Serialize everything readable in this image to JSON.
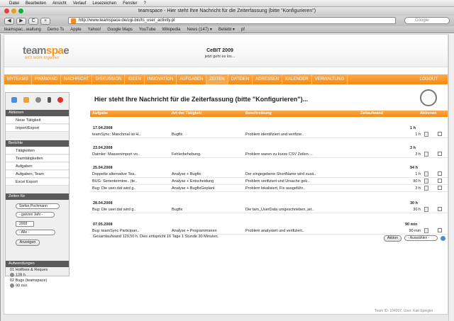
{
  "menubar": {
    "items": [
      "Datei",
      "Bearbeiten",
      "Ansicht",
      "Verlauf",
      "Lesezeichen",
      "Fenster",
      "?"
    ]
  },
  "window": {
    "title": "teamspace - Hier steht Ihre Nachricht für die Zeiterfassung (bitte \"Konfigurieren\")"
  },
  "toolbar": {
    "back": "◀",
    "forward": "▶",
    "reload": "C",
    "add": "+",
    "url": "http://www.teamspace.de/cgi-bin/ts_user_activity.pl",
    "search_placeholder": "Google"
  },
  "bookmarks": [
    "teamspac...waltung",
    "Demo Ts",
    "Apple",
    "Yahoo!",
    "Google Maps",
    "YouTube",
    "Wikipedia",
    "News (147) ▾",
    "Beliebt ▾",
    "pf"
  ],
  "header": {
    "logo_a": "team",
    "logo_b": "spa",
    "logo_c": "e",
    "tagline": "let's work  together",
    "event_title": "CeBIT 2009",
    "event_sub": "jetzt geht es los..."
  },
  "nav": {
    "items": [
      "MYTEAMS",
      "PINNWAND",
      "NACHRICHT",
      "DISKUSSION",
      "IDEEN",
      "INNOVATION",
      "AUFGABEN",
      "ZEITEN",
      "DATEIEN",
      "ADRESSEN",
      "KALENDER",
      "VERWALTUNG"
    ],
    "active": "ZEITEN",
    "logout": "LOGOUT"
  },
  "sidebar": {
    "aktionen_title": "Aktionen",
    "aktionen": [
      "Neue Tätigkeit",
      "Import/Export"
    ],
    "berichte_title": "Berichte",
    "berichte": [
      "Tätigkeiten",
      "Teamtätigkeiten",
      "Aufgaben",
      "Aufgaben, Team",
      "Excel Export"
    ],
    "zeiten_title": "Zeiten für",
    "user": "Stefan Pochmann",
    "period": "- ganzes Jahr -",
    "year": "2008",
    "filter": "- Alle -",
    "show_button": "Anzeigen",
    "aufwendungen_title": "Aufwendungen",
    "aufw": [
      "01 Hotfixes & Reques",
      "128 h",
      "02 Bugs (teamspace)",
      "90 min"
    ]
  },
  "main": {
    "heading": "Hier steht Ihre Nachricht für die Zeiterfassung (bitte \"Konfigurieren\")...",
    "columns": [
      "Aufgabe",
      "Art der Tätigkeit",
      "Beschreibung",
      "Zeitaufwand",
      "Aktionen"
    ],
    "groups": [
      {
        "date": "17.04.2008",
        "total": "1 h",
        "rows": [
          [
            "teamSync: Manchmal ist H..",
            "Bugfix",
            "Problem identifiziert und verifizie..",
            "1 h"
          ]
        ]
      },
      {
        "date": "23.04.2008",
        "total": "3 h",
        "rows": [
          [
            "Daimler: Massenimport vo..",
            "Fehlerbehebung.",
            "Problem waren zu kurze CSV Zeilen. ..",
            "3 h"
          ]
        ]
      },
      {
        "date": "25.04.2008",
        "total": "94 h",
        "rows": [
          [
            "Doppelte alternative Tea..",
            "Analyse + Bugfix",
            "Der eingegebene ShortName wird zusä..",
            "1 h"
          ],
          [
            "BUG: Serientermine.. (te..",
            "Analyse + Entscheidung",
            "Problem verifiziert und Ursache gek..",
            "90 h"
          ],
          [
            "Bug: Die user.dat wird g..",
            "Analyse + BugfixGeplant",
            "Problem lokalisiert, Fix ausgeführ..",
            "3 h"
          ]
        ]
      },
      {
        "date": "28.04.2008",
        "total": "30 h",
        "rows": [
          [
            "Bug: Die user.dat wird g..",
            "Bugfix",
            "Die tam_UserData umgeschrieben, jet..",
            "30 h"
          ]
        ]
      },
      {
        "date": "07.05.2008",
        "total": "90 min",
        "rows": [
          [
            "Bug: teamSync Participan..",
            "Analyse + Programmieren",
            "Problem analysiert und verifiziert..",
            "90 min"
          ]
        ]
      }
    ],
    "summary": "Gesamtaufwand 129,50 h. Dies entspricht  16 Tage 1 Stunde 30 Minuten.",
    "action_button": "Aktion",
    "action_select": "- Auswählen -"
  },
  "footer": "Team ID: 104207, User: Kati Spiegler",
  "colors": {
    "orange": "#f58a12",
    "dark": "#5a5a5a"
  }
}
